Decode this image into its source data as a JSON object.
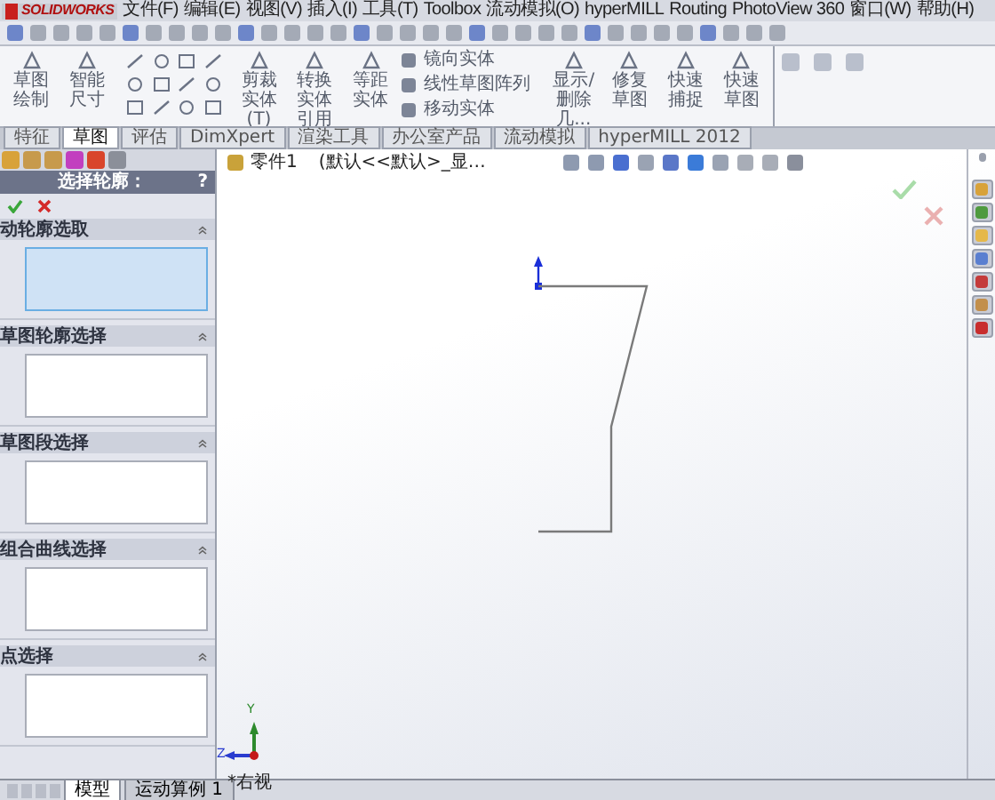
{
  "menu": {
    "logo": "SOLIDWORKS",
    "items": [
      "文件(F)",
      "编辑(E)",
      "视图(V)",
      "插入(I)",
      "工具(T)",
      "Toolbox",
      "流动模拟(O)",
      "hyperMILL",
      "Routing",
      "PhotoView 360",
      "窗口(W)",
      "帮助(H)"
    ]
  },
  "ribbon": {
    "items": [
      {
        "kind": "large",
        "label": "草图绘制"
      },
      {
        "kind": "large",
        "label": "智能尺寸"
      },
      {
        "kind": "tools"
      },
      {
        "kind": "large",
        "label": "剪裁实体(T)"
      },
      {
        "kind": "large",
        "label": "转换实体引用"
      },
      {
        "kind": "large",
        "label": "等距实体"
      },
      {
        "kind": "stack",
        "rows": [
          "镜向实体",
          "线性草图阵列",
          "移动实体"
        ]
      },
      {
        "kind": "large",
        "label": "显示/删除几..."
      },
      {
        "kind": "large",
        "label": "修复草图"
      },
      {
        "kind": "large",
        "label": "快速捕捉"
      },
      {
        "kind": "large",
        "label": "快速草图"
      }
    ]
  },
  "tabs": [
    {
      "label": "特征",
      "selected": false
    },
    {
      "label": "草图",
      "selected": true
    },
    {
      "label": "评估",
      "selected": false
    },
    {
      "label": "DimXpert",
      "selected": false
    },
    {
      "label": "渲染工具",
      "selected": false
    },
    {
      "label": "办公室产品",
      "selected": false
    },
    {
      "label": "流动模拟",
      "selected": false
    },
    {
      "label": "hyperMILL 2012",
      "selected": false
    }
  ],
  "panel": {
    "title": "选择轮廓：",
    "help": "?",
    "sections": [
      {
        "title": "动轮廓选取",
        "selected": true
      },
      {
        "title": "草图轮廓选择",
        "selected": false
      },
      {
        "title": "草图段选择",
        "selected": false
      },
      {
        "title": "组合曲线选择",
        "selected": false
      },
      {
        "title": "点选择",
        "selected": false
      }
    ]
  },
  "canvas": {
    "part": "零件1",
    "config": "(默认<<默认>_显…",
    "view_label": "*右视",
    "axis_y": "Y",
    "axis_z": "Z"
  },
  "bottom_tabs": [
    {
      "label": "模型",
      "selected": true
    },
    {
      "label": "运动算例 1",
      "selected": false
    }
  ]
}
